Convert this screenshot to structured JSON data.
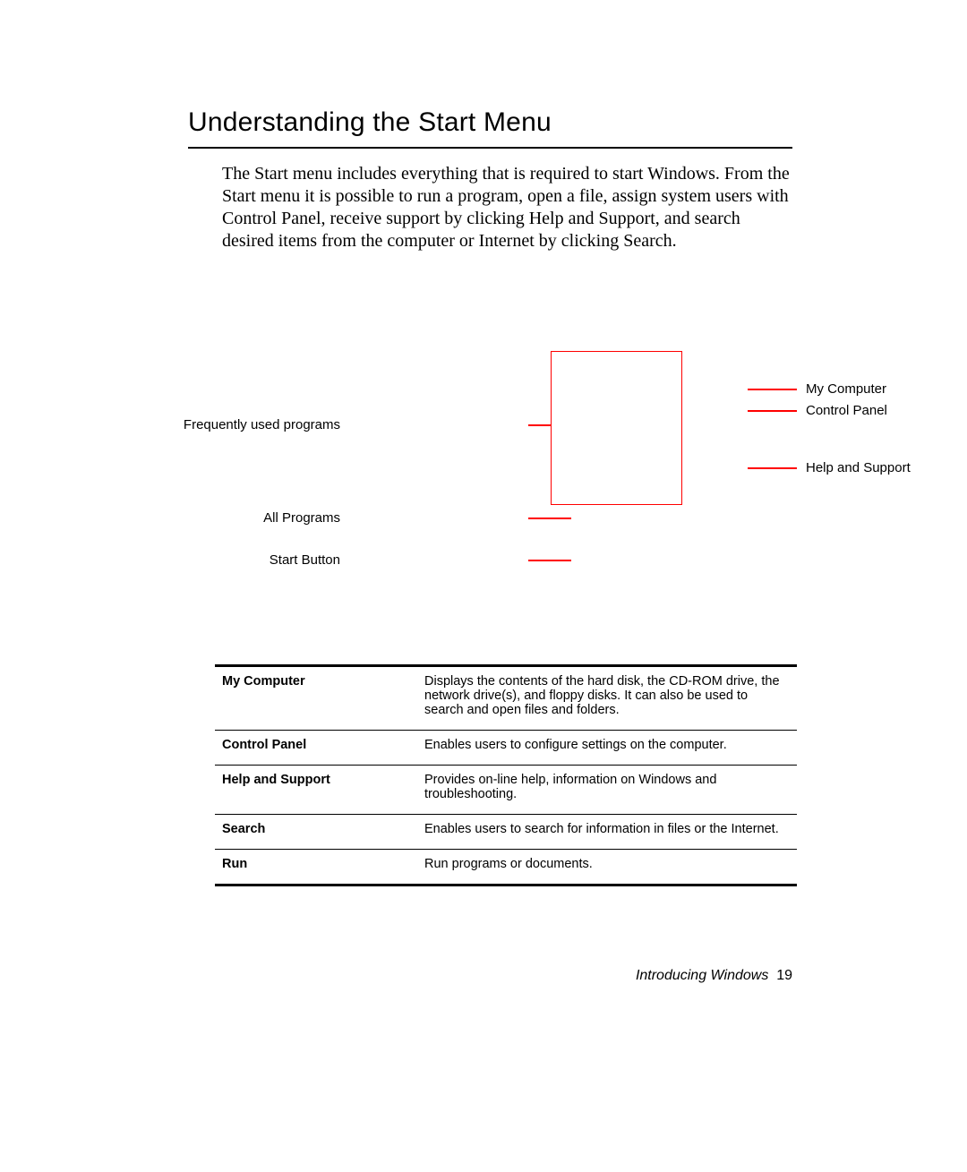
{
  "header": {
    "title": "Understanding the Start Menu"
  },
  "intro": "The Start menu includes everything that is required to start Windows. From the Start menu it is possible to run a program, open a file, assign system users with Control Panel, receive support by clicking Help and Support, and search desired items from the computer or Internet by clicking Search.",
  "diagram": {
    "left_labels": {
      "frequently": "Frequently used programs",
      "all_programs": "All Programs",
      "start_button": "Start Button"
    },
    "right_labels": {
      "my_computer": "My Computer",
      "control_panel": "Control Panel",
      "help_support": "Help and Support"
    }
  },
  "table": {
    "rows": [
      {
        "term": "My Computer",
        "desc": "Displays the contents of the hard disk, the CD-ROM drive, the network drive(s), and floppy disks. It can also be used to search and open files and folders."
      },
      {
        "term": "Control Panel",
        "desc": "Enables users to configure settings on the computer."
      },
      {
        "term": "Help and Support",
        "desc": "Provides on-line help, information on Windows and troubleshooting."
      },
      {
        "term": "Search",
        "desc": "Enables users to search for information in files or the Internet."
      },
      {
        "term": "Run",
        "desc": "Run programs or documents."
      }
    ]
  },
  "footer": {
    "chapter": "Introducing Windows",
    "page_number": "19"
  }
}
